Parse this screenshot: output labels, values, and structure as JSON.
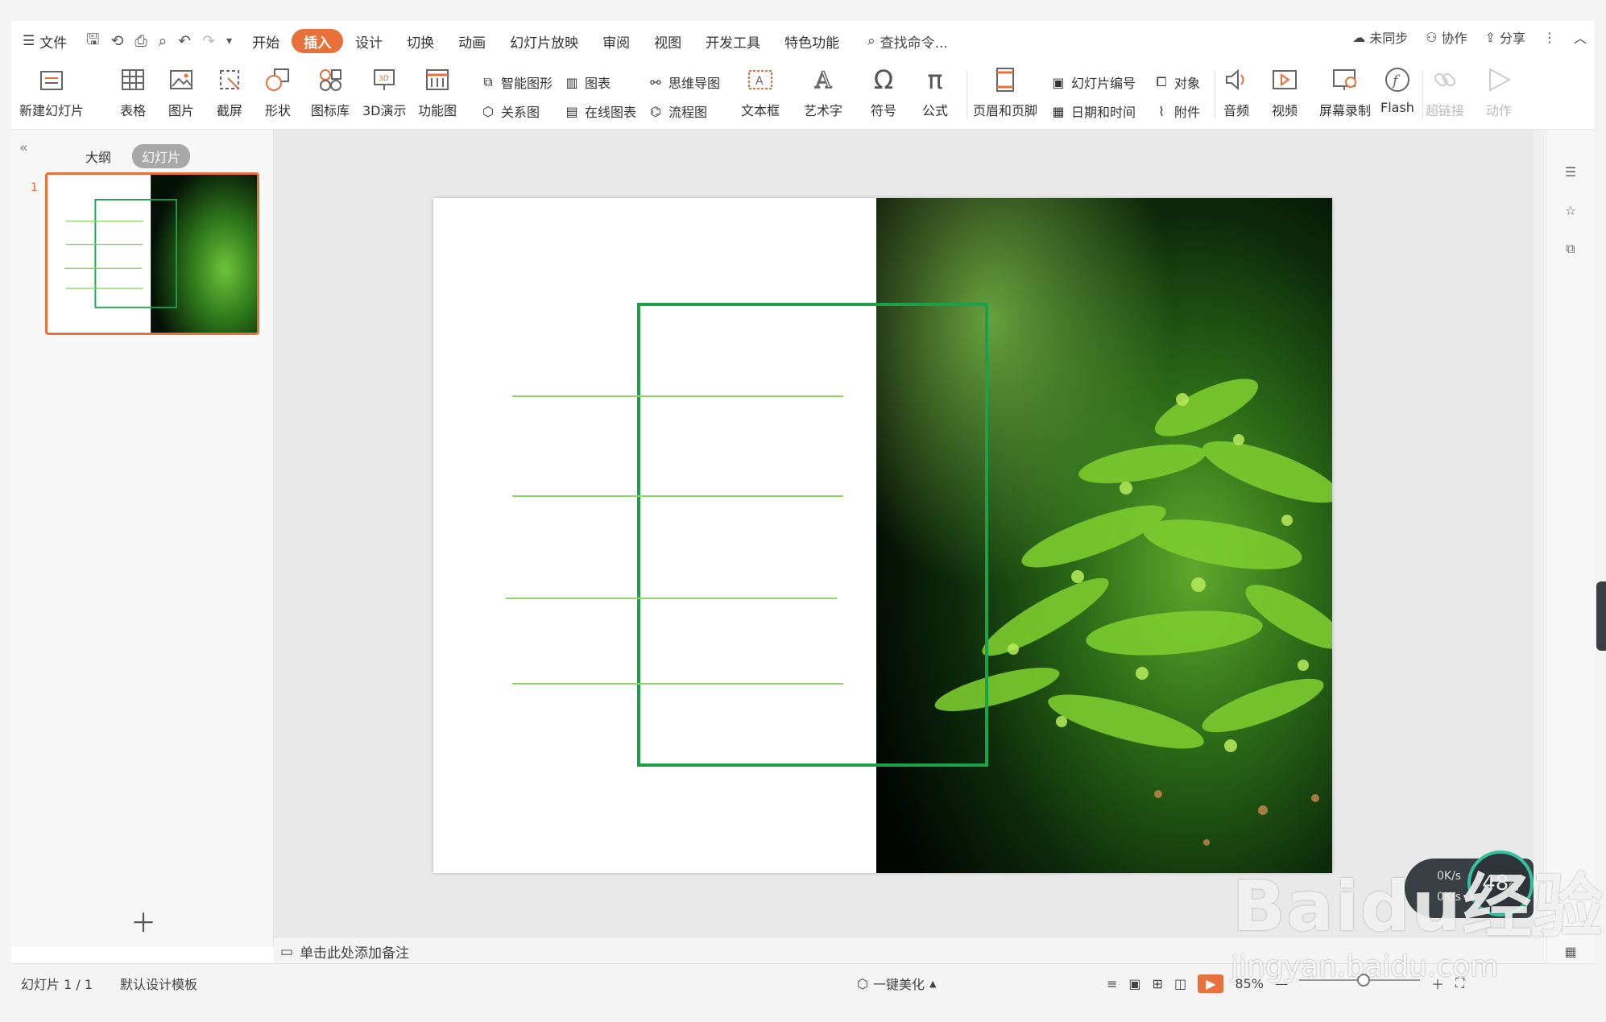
{
  "menubar": {
    "file_label": "文件",
    "tabs": [
      "开始",
      "插入",
      "设计",
      "切换",
      "动画",
      "幻灯片放映",
      "审阅",
      "视图",
      "开发工具",
      "特色功能"
    ],
    "active_tab": "插入",
    "search_placeholder": "查找命令...",
    "sync_label": "未同步",
    "collab_label": "协作",
    "share_label": "分享"
  },
  "ribbon": {
    "new_slide": "新建幻灯片",
    "table": "表格",
    "picture": "图片",
    "screenshot": "截屏",
    "shape": "形状",
    "icon_lib": "图标库",
    "demo3d": "3D演示",
    "func_chart": "功能图",
    "smart_art": "智能图形",
    "relation": "关系图",
    "chart": "图表",
    "online_chart": "在线图表",
    "mind_map": "思维导图",
    "flow_chart": "流程图",
    "textbox": "文本框",
    "wordart": "艺术字",
    "symbol": "符号",
    "formula": "公式",
    "header_footer": "页眉和页脚",
    "slide_number": "幻灯片编号",
    "datetime": "日期和时间",
    "object": "对象",
    "attachment": "附件",
    "audio": "音频",
    "video": "视频",
    "screen_record": "屏幕录制",
    "flash": "Flash",
    "hyperlink": "超链接",
    "action": "动作"
  },
  "leftpanel": {
    "tab_outline": "大纲",
    "tab_slides": "幻灯片",
    "slide_number": "1"
  },
  "notes": {
    "placeholder": "单击此处添加备注"
  },
  "status": {
    "slide_info": "幻灯片 1 / 1",
    "template": "默认设计模板",
    "beautify": "一键美化",
    "zoom": "85%"
  },
  "overlay": {
    "net_up": "0K/s",
    "net_down": "0K/s",
    "percent": "48",
    "percent_sign": "%",
    "watermark_main": "Baidu经验",
    "watermark_url": "jingyan.baidu.com"
  },
  "colors": {
    "accent": "#e8703a",
    "frame_green": "#1ba14a",
    "line_green": "#8fd36a"
  }
}
